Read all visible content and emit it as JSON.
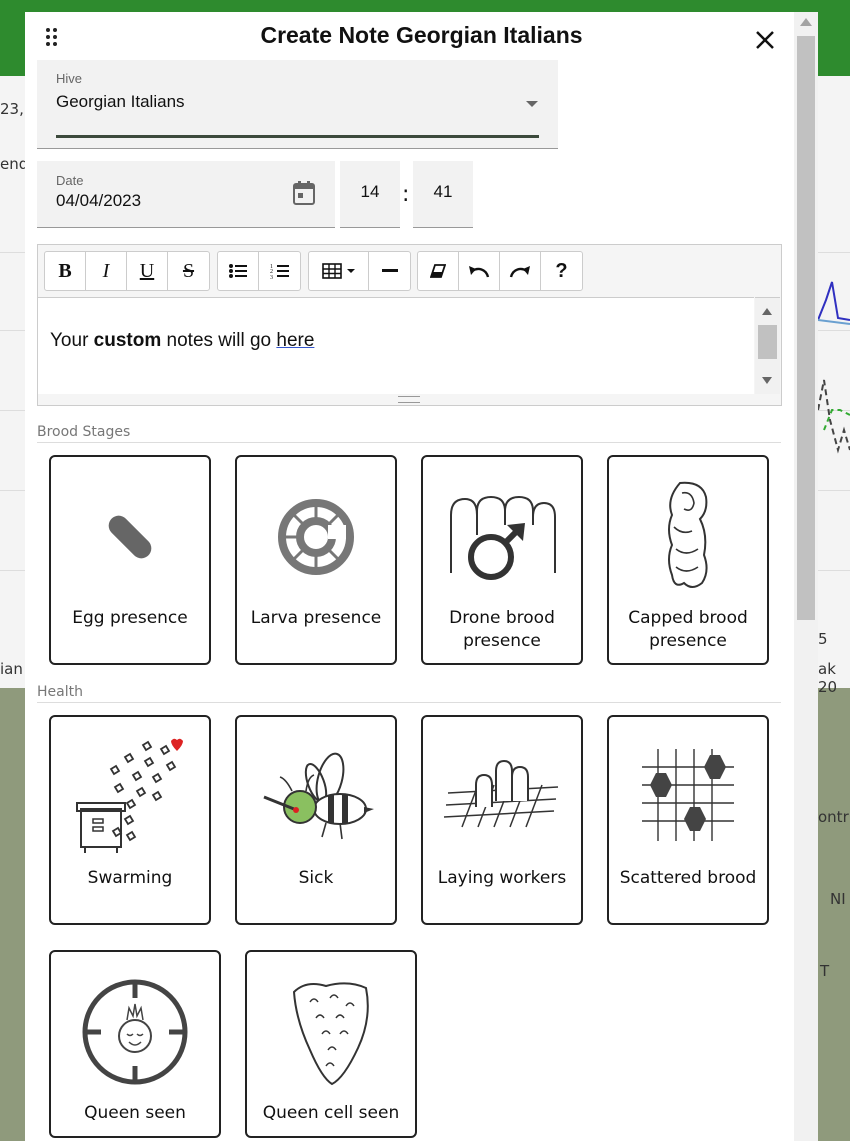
{
  "background": {
    "left_texts": [
      "23,",
      "end",
      "ian"
    ],
    "right_texts": [
      "5",
      "ak 20",
      "ontr",
      "NI",
      "T"
    ]
  },
  "modal": {
    "title": "Create Note Georgian Italians",
    "close_icon": "close-icon",
    "drag_icon": "drag-handle-icon"
  },
  "hive": {
    "label": "Hive",
    "value": "Georgian Italians"
  },
  "date": {
    "label": "Date",
    "value": "04/04/2023",
    "hour": "14",
    "separator": ":",
    "minute": "41"
  },
  "editor": {
    "toolbar": {
      "bold": "B",
      "italic": "I",
      "underline": "U",
      "strike": "S",
      "help": "?"
    },
    "content": {
      "prefix": "Your ",
      "bold_word": "custom",
      "middle": " notes will go ",
      "underlined_word": "here"
    }
  },
  "sections": {
    "brood": {
      "title": "Brood Stages",
      "cards": [
        {
          "label": "Egg presence",
          "icon": "egg-icon"
        },
        {
          "label": "Larva presence",
          "icon": "larva-icon"
        },
        {
          "label": "Drone brood presence",
          "icon": "drone-brood-icon"
        },
        {
          "label": "Capped brood presence",
          "icon": "capped-brood-icon"
        }
      ]
    },
    "health": {
      "title": "Health",
      "cards": [
        {
          "label": "Swarming",
          "icon": "swarming-icon"
        },
        {
          "label": "Sick",
          "icon": "sick-bee-icon"
        },
        {
          "label": "Laying workers",
          "icon": "laying-workers-icon"
        },
        {
          "label": "Scattered brood",
          "icon": "scattered-brood-icon"
        },
        {
          "label": "Queen seen",
          "icon": "queen-seen-icon"
        },
        {
          "label": "Queen cell seen",
          "icon": "queen-cell-icon"
        }
      ]
    }
  },
  "colors": {
    "accent_green": "#2e8b2e",
    "field_underline": "#3c4a3c",
    "card_border": "#222222"
  }
}
